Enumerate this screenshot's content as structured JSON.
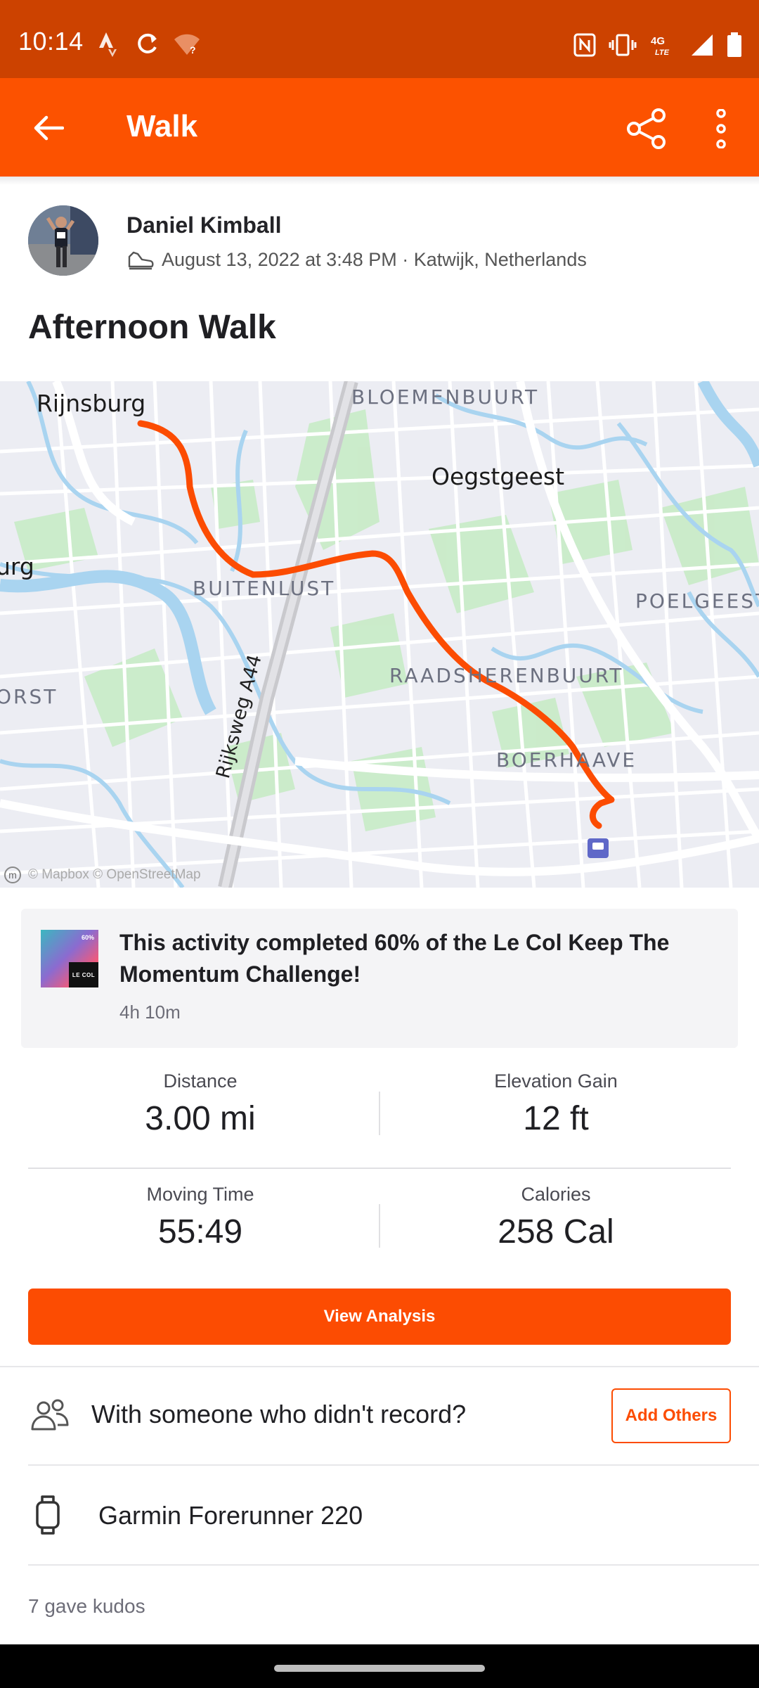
{
  "status_bar": {
    "time": "10:14",
    "network": "4G LTE",
    "icons": [
      "strava-status-icon",
      "sync-icon",
      "wifi-question-icon",
      "nfc-icon",
      "vibrate-icon",
      "signal-icon",
      "battery-icon"
    ]
  },
  "app_bar": {
    "title": "Walk",
    "back_icon": "arrow-left-icon",
    "share_icon": "share-icon",
    "more_icon": "more-vertical-icon"
  },
  "header": {
    "athlete_name": "Daniel Kimball",
    "activity_meta": "August 13, 2022 at 3:48 PM · Katwijk, Netherlands",
    "activity_type_icon": "walking-shoe-icon",
    "activity_title": "Afternoon Walk"
  },
  "map": {
    "labels": {
      "rijnsburg": "Rijnsburg",
      "bloemenbuurt": "BLOEMENBUURT",
      "oegstgeest": "Oegstgeest",
      "burg": "urg",
      "buitenlust": "BUITENLUST",
      "poelgeest": "POELGEEST",
      "raadsherenbuurt": "RAADSHERENBUURT",
      "orst": "ORST",
      "rijksweg": "Rijksweg A44",
      "boerhaave": "BOERHAAVE"
    },
    "attribution": "© Mapbox © OpenStreetMap",
    "route_color": "#fc4c02"
  },
  "challenge": {
    "text": "This activity completed 60% of the Le Col Keep The Momentum Challenge!",
    "time": "4h 10m",
    "badge_percent": "60%",
    "badge_logo": "LE COL"
  },
  "stats": {
    "distance_label": "Distance",
    "distance_value": "3.00 mi",
    "elevation_label": "Elevation Gain",
    "elevation_value": "12 ft",
    "moving_time_label": "Moving Time",
    "moving_time_value": "55:49",
    "calories_label": "Calories",
    "calories_value": "258 Cal"
  },
  "actions": {
    "view_analysis": "View Analysis",
    "with_someone": "With someone who didn't record?",
    "add_others": "Add Others",
    "device": "Garmin Forerunner 220",
    "kudos": "7 gave kudos"
  },
  "colors": {
    "brand": "#fc5200",
    "status_bar": "#cc4200",
    "accent": "#fc4c02"
  }
}
